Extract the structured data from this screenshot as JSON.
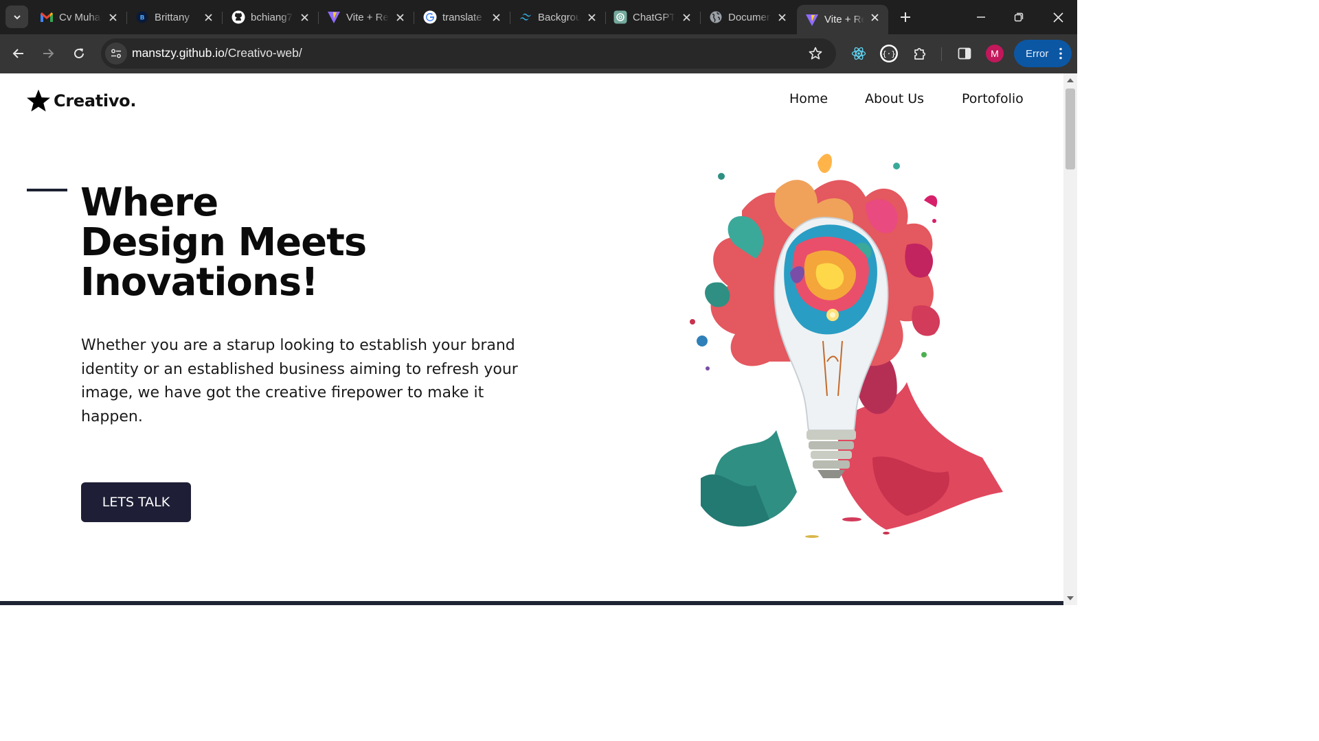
{
  "browser": {
    "tabs": [
      {
        "title": "Cv Muhammad",
        "icon": "gmail-icon"
      },
      {
        "title": "Brittany",
        "icon": "b-icon"
      },
      {
        "title": "bchiang7",
        "icon": "github-icon"
      },
      {
        "title": "Vite + React",
        "icon": "vite-icon"
      },
      {
        "title": "translate",
        "icon": "google-icon"
      },
      {
        "title": "Background",
        "icon": "tailwind-icon"
      },
      {
        "title": "ChatGPT",
        "icon": "chatgpt-icon"
      },
      {
        "title": "Document",
        "icon": "globe-icon"
      },
      {
        "title": "Vite + React",
        "icon": "vite-icon",
        "active": true
      }
    ],
    "url_host": "manstzy.github.io",
    "url_path": "/Creativo-web/",
    "profile_initial": "M",
    "error_label": "Error"
  },
  "site": {
    "logo_text": "Creativo.",
    "nav": [
      "Home",
      "About Us",
      "Portofolio"
    ],
    "hero_title_lines": [
      "Where",
      "Design Meets",
      "Inovations!"
    ],
    "hero_text": "Whether you are a starup looking to establish your brand identity or an established business aiming to refresh your image, we have got the creative firepower to make it happen.",
    "cta_label": "LETS TALK",
    "colors": {
      "accent": "#1e1f36",
      "text": "#0b0b0b"
    }
  }
}
